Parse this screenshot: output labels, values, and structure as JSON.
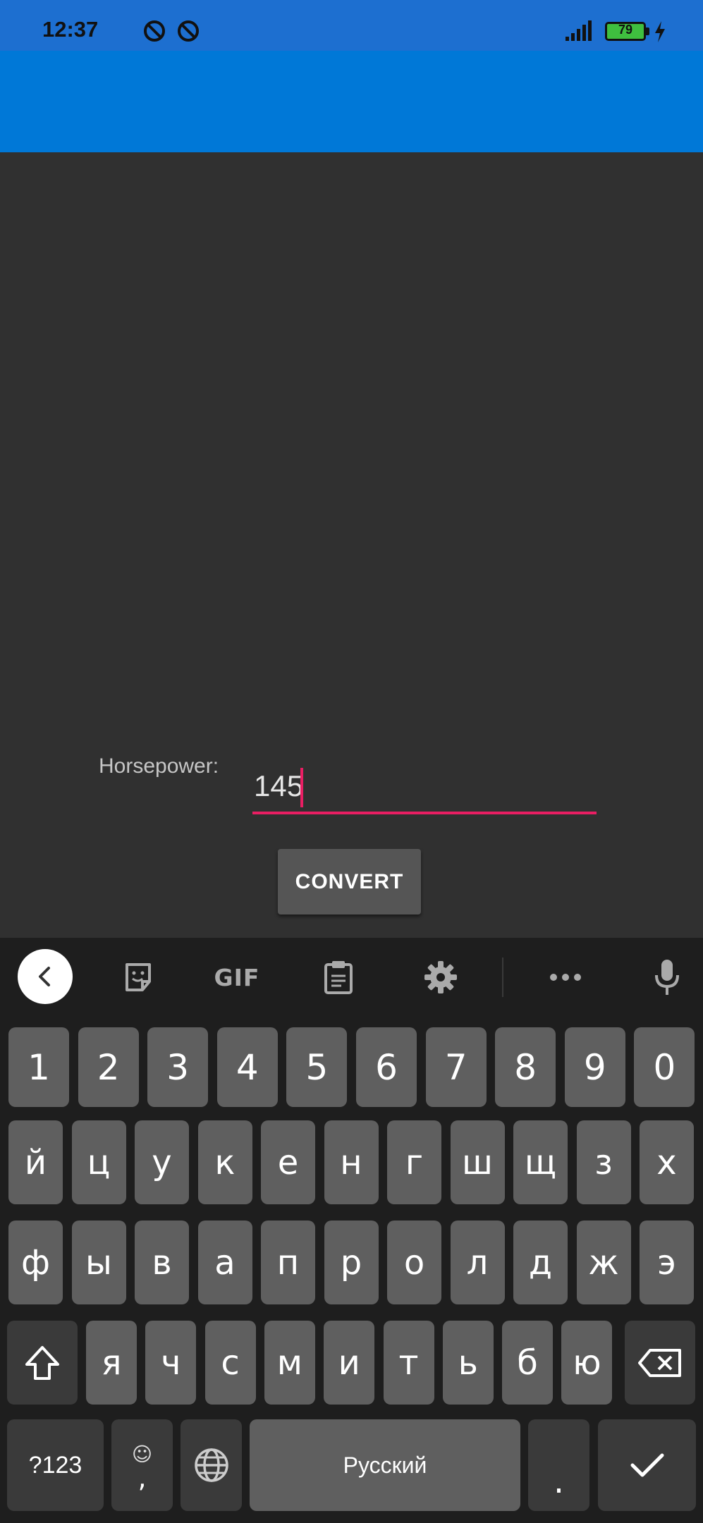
{
  "status_bar": {
    "time": "12:37",
    "battery_level": "79",
    "icons": [
      "do-not-disturb-icon",
      "do-not-disturb-icon",
      "signal-icon",
      "battery-icon",
      "charging-icon"
    ]
  },
  "form": {
    "label": "Horsepower:",
    "input_value": "145",
    "button_label": "CONVERT",
    "accent_color": "#e91e63"
  },
  "keyboard": {
    "toolbar_gif": "GIF",
    "number_row": [
      "1",
      "2",
      "3",
      "4",
      "5",
      "6",
      "7",
      "8",
      "9",
      "0"
    ],
    "row1": [
      "й",
      "ц",
      "у",
      "к",
      "е",
      "н",
      "г",
      "ш",
      "щ",
      "з",
      "х"
    ],
    "row2": [
      "ф",
      "ы",
      "в",
      "а",
      "п",
      "р",
      "о",
      "л",
      "д",
      "ж",
      "э"
    ],
    "row3": [
      "я",
      "ч",
      "с",
      "м",
      "и",
      "т",
      "ь",
      "б",
      "ю"
    ],
    "symbols_key": "?123",
    "comma_key": ",",
    "space_label": "Русский",
    "period_key": "."
  },
  "colors": {
    "status_bar": "#1d6fd0",
    "app_bar": "#0078d7",
    "background": "#303030"
  }
}
